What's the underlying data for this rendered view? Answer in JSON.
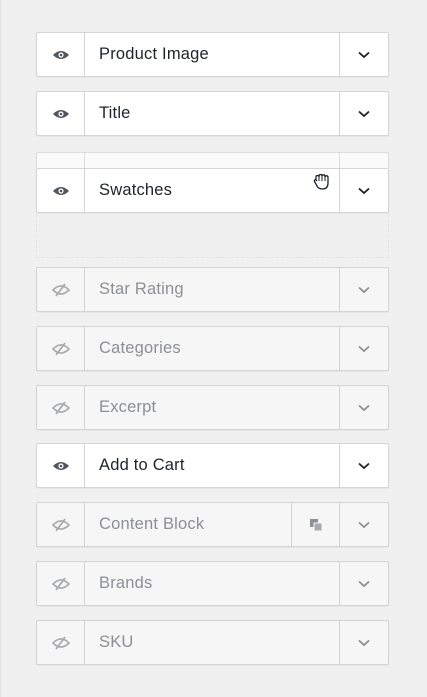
{
  "fields": [
    {
      "label": "Product Image",
      "visible": true,
      "icon": "eye-icon"
    },
    {
      "label": "Title",
      "visible": true,
      "icon": "eye-icon"
    },
    {
      "label": "Swatches",
      "visible": true,
      "icon": "eye-icon",
      "state": "dragging"
    },
    {
      "label": "Star Rating",
      "visible": false,
      "icon": "eye-slash-icon"
    },
    {
      "label": "Categories",
      "visible": false,
      "icon": "eye-slash-icon"
    },
    {
      "label": "Excerpt",
      "visible": false,
      "icon": "eye-slash-icon"
    },
    {
      "label": "Add to Cart",
      "visible": true,
      "icon": "eye-icon"
    },
    {
      "label": "Content Block",
      "visible": false,
      "icon": "eye-slash-icon",
      "extra_icon": "duplicate-icon"
    },
    {
      "label": "Brands",
      "visible": false,
      "icon": "eye-slash-icon"
    },
    {
      "label": "SKU",
      "visible": false,
      "icon": "eye-slash-icon"
    }
  ],
  "colors": {
    "text": "#1d2327",
    "text_disabled": "#8c8f94",
    "border": "#d4d4d6",
    "background": "#f0f0f1",
    "icon": "#50575e",
    "icon_disabled": "#a7aaad"
  }
}
